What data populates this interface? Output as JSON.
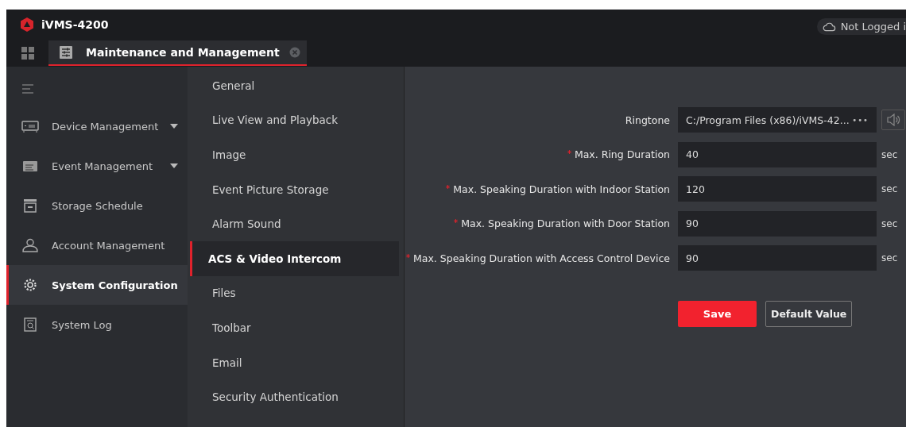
{
  "app": {
    "title": "iVMS-4200",
    "account_status": "Not Logged i"
  },
  "tabs": [
    {
      "label": "Maintenance and Management",
      "selected": true
    }
  ],
  "sidebar": {
    "items": [
      {
        "label": "Device Management",
        "expandable": true,
        "selected": false
      },
      {
        "label": "Event Management",
        "expandable": true,
        "selected": false
      },
      {
        "label": "Storage Schedule",
        "expandable": false,
        "selected": false
      },
      {
        "label": "Account Management",
        "expandable": false,
        "selected": false
      },
      {
        "label": "System Configuration",
        "expandable": false,
        "selected": true
      },
      {
        "label": "System Log",
        "expandable": false,
        "selected": false
      }
    ]
  },
  "settings_nav": [
    {
      "label": "General",
      "selected": false
    },
    {
      "label": "Live View and Playback",
      "selected": false
    },
    {
      "label": "Image",
      "selected": false
    },
    {
      "label": "Event Picture Storage",
      "selected": false
    },
    {
      "label": "Alarm Sound",
      "selected": false
    },
    {
      "label": "ACS & Video Intercom",
      "selected": true
    },
    {
      "label": "Files",
      "selected": false
    },
    {
      "label": "Toolbar",
      "selected": false
    },
    {
      "label": "Email",
      "selected": false
    },
    {
      "label": "Security Authentication",
      "selected": false
    }
  ],
  "form": {
    "fields": [
      {
        "kind": "file",
        "label": "Ringtone",
        "required": false,
        "value": "C:/Program Files (x86)/iVMS-42...",
        "browse": "•••"
      },
      {
        "kind": "number",
        "label": "Max. Ring Duration",
        "required": true,
        "value": "40",
        "unit": "sec"
      },
      {
        "kind": "number",
        "label": "Max. Speaking Duration with Indoor Station",
        "required": true,
        "value": "120",
        "unit": "sec"
      },
      {
        "kind": "number",
        "label": "Max. Speaking Duration with Door Station",
        "required": true,
        "value": "90",
        "unit": "sec"
      },
      {
        "kind": "number",
        "label": "Max. Speaking Duration with Access Control Device",
        "required": true,
        "value": "90",
        "unit": "sec"
      }
    ],
    "buttons": [
      {
        "kind": "primary",
        "label": "Save"
      },
      {
        "kind": "secondary",
        "label": "Default Value"
      }
    ]
  }
}
